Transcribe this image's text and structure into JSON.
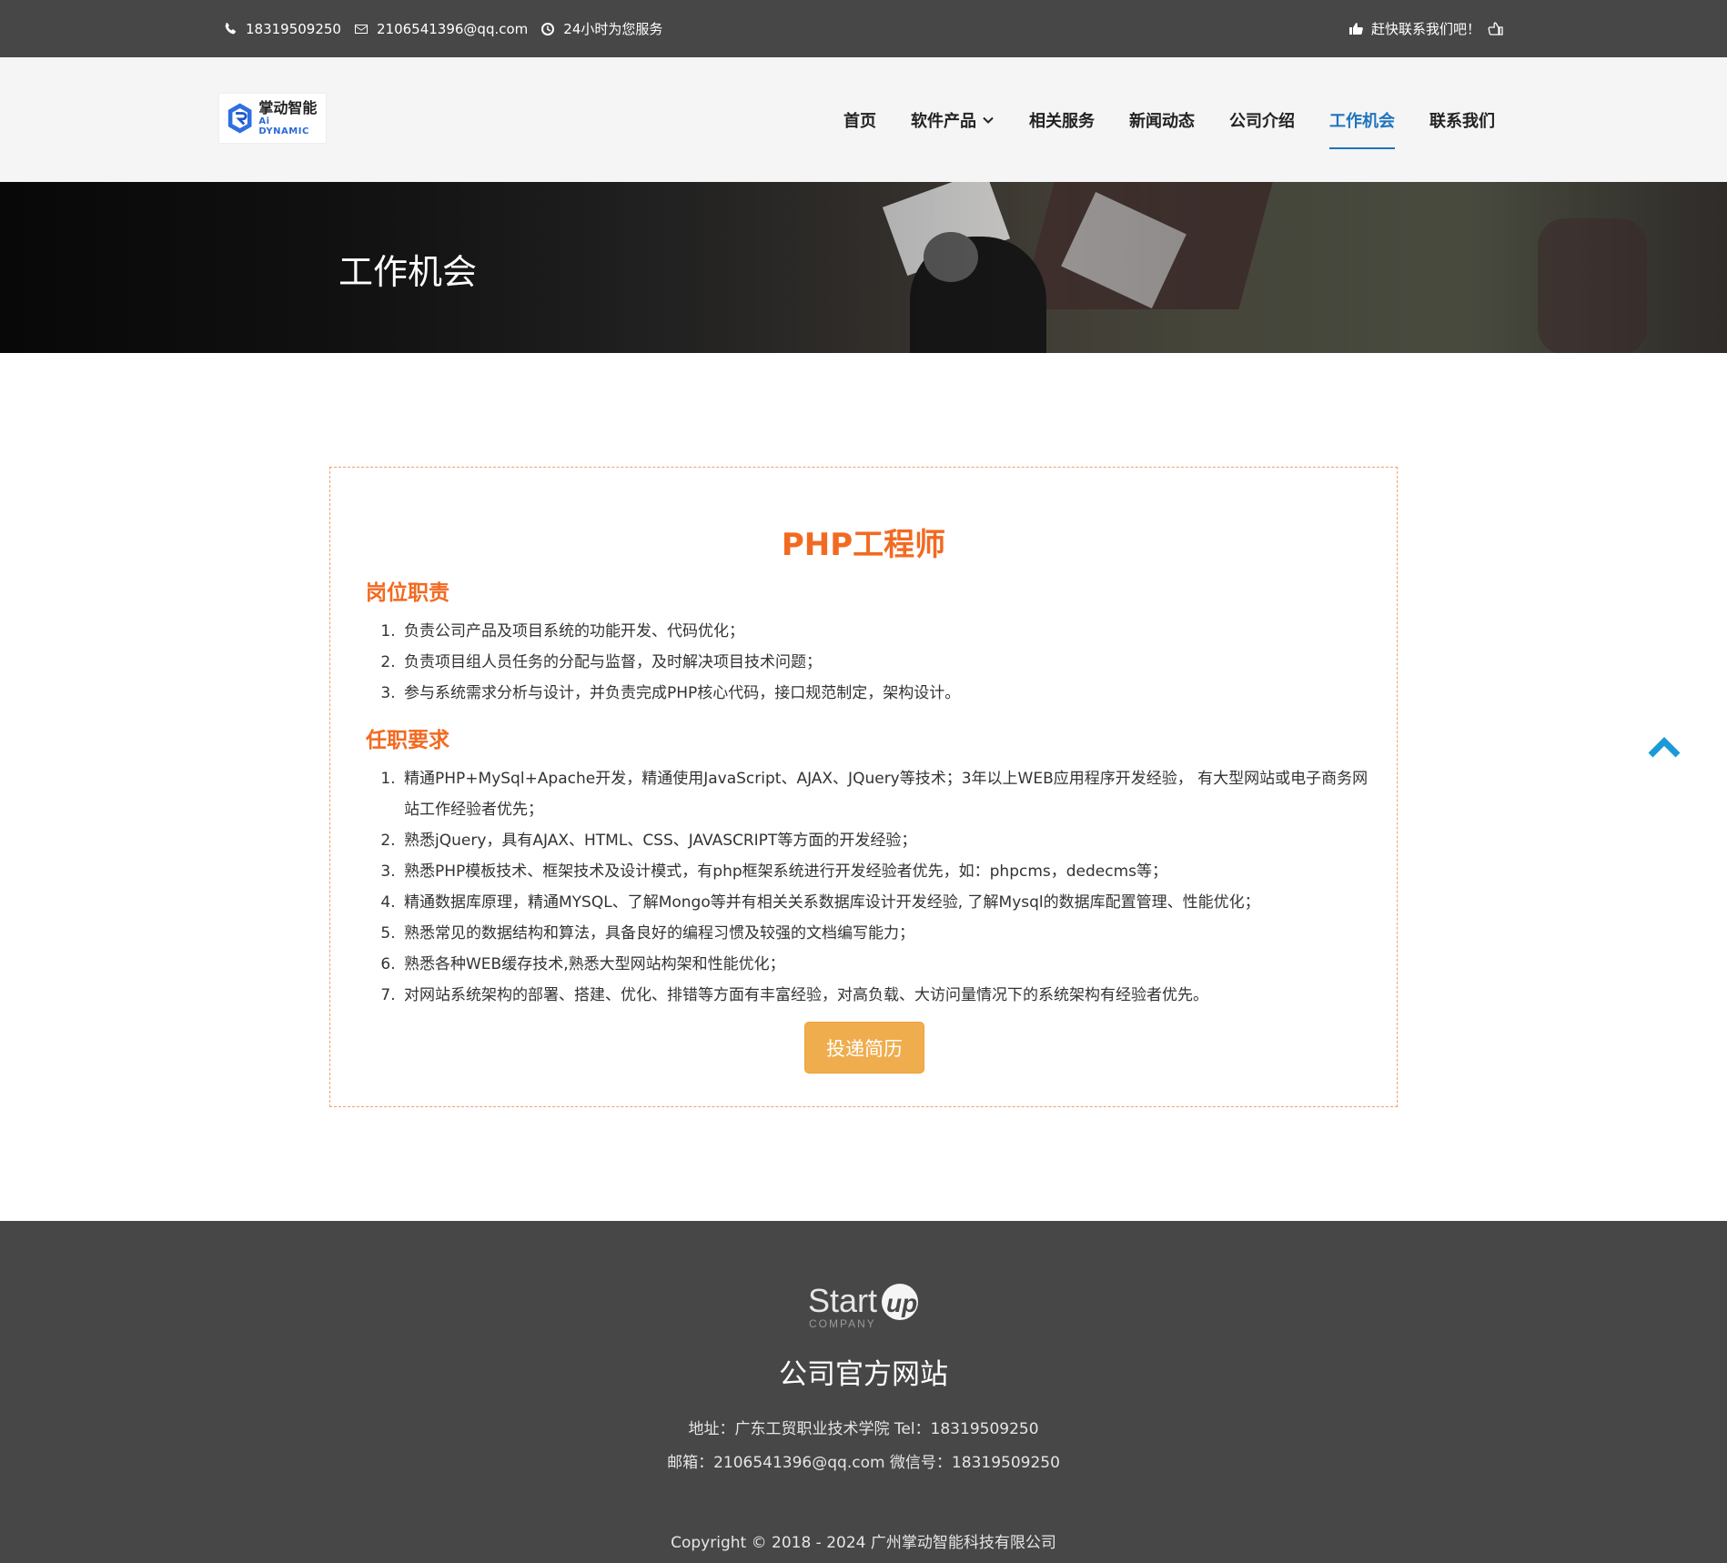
{
  "topbar": {
    "phone": "18319509250",
    "email": "2106541396@qq.com",
    "hours": "24小时为您服务",
    "cta": "赶快联系我们吧！"
  },
  "logo": {
    "cn": "掌动智能",
    "en": "Ai DYNAMIC"
  },
  "nav": {
    "items": [
      "首页",
      "软件产品",
      "相关服务",
      "新闻动态",
      "公司介绍",
      "工作机会",
      "联系我们"
    ],
    "active": "工作机会"
  },
  "banner": {
    "title": "工作机会"
  },
  "job": {
    "title": "PHP工程师",
    "duties_title": "岗位职责",
    "duties": [
      "负责公司产品及项目系统的功能开发、代码优化；",
      "负责项目组人员任务的分配与监督，及时解决项目技术问题；",
      "参与系统需求分析与设计，并负责完成PHP核心代码，接口规范制定，架构设计。"
    ],
    "reqs_title": "任职要求",
    "reqs": [
      "精通PHP+MySql+Apache开发，精通使用JavaScript、AJAX、JQuery等技术；3年以上WEB应用程序开发经验， 有大型网站或电子商务网站工作经验者优先；",
      "熟悉jQuery，具有AJAX、HTML、CSS、JAVASCRIPT等方面的开发经验；",
      "熟悉PHP模板技术、框架技术及设计模式，有php框架系统进行开发经验者优先，如：phpcms，dedecms等；",
      "精通数据库原理，精通MYSQL、了解Mongo等并有相关关系数据库设计开发经验, 了解Mysql的数据库配置管理、性能优化；",
      "熟悉常见的数据结构和算法，具备良好的编程习惯及较强的文档编写能力；",
      "熟悉各种WEB缓存技术,熟悉大型网站构架和性能优化；",
      "对网站系统架构的部署、搭建、优化、排错等方面有丰富经验，对高负载、大访问量情况下的系统架构有经验者优先。"
    ],
    "apply_label": "投递简历"
  },
  "footer": {
    "logo_main": "Start",
    "logo_up": "up",
    "logo_sub": "COMPANY",
    "site_name": "公司官方网站",
    "address_line": "地址：广东工贸职业技术学院 Tel：18319509250",
    "contact_line": "邮箱：2106541396@qq.com 微信号：18319509250",
    "copyright": "Copyright © 2018 - 2024 广州掌动智能科技有限公司"
  },
  "colors": {
    "topbar_bg": "#474747",
    "accent_orange": "#f26a21",
    "nav_active": "#1e73be",
    "apply_button": "#f0ad4e",
    "backtop_icon": "#1a9bd7"
  },
  "icons": [
    "phone-icon",
    "mail-icon",
    "clock-icon",
    "pointing-hand-icon",
    "hand-icon",
    "chevron-down-icon",
    "chevron-up-icon"
  ]
}
